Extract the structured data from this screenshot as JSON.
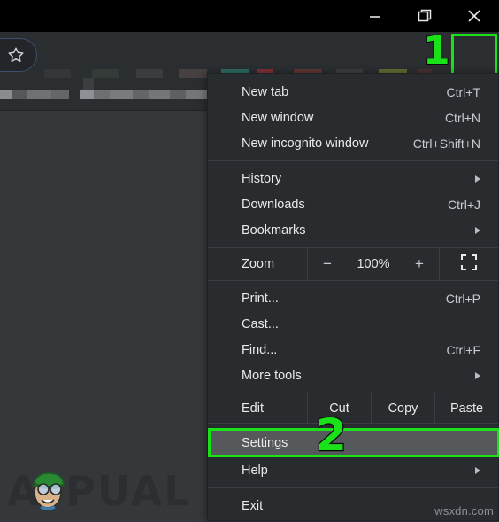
{
  "window": {
    "controls": [
      {
        "name": "minimize",
        "glyph": "minimize-icon"
      },
      {
        "name": "maximize",
        "glyph": "restore-icon"
      },
      {
        "name": "close",
        "glyph": "close-icon"
      }
    ]
  },
  "toolbar": {
    "bookmark_star": "star-icon",
    "menu_button": "three-dot-menu-icon",
    "annotation_1": "1"
  },
  "menu": {
    "groups": [
      {
        "items": [
          {
            "label": "New tab",
            "accel": "Ctrl+T",
            "arrow": false
          },
          {
            "label": "New window",
            "accel": "Ctrl+N",
            "arrow": false
          },
          {
            "label": "New incognito window",
            "accel": "Ctrl+Shift+N",
            "arrow": false
          }
        ]
      },
      {
        "items": [
          {
            "label": "History",
            "accel": "",
            "arrow": true
          },
          {
            "label": "Downloads",
            "accel": "Ctrl+J",
            "arrow": false
          },
          {
            "label": "Bookmarks",
            "accel": "",
            "arrow": true
          }
        ]
      }
    ],
    "zoom": {
      "label": "Zoom",
      "minus": "−",
      "value": "100%",
      "plus": "+",
      "fullscreen": "fullscreen-icon"
    },
    "tools": [
      {
        "label": "Print...",
        "accel": "Ctrl+P",
        "arrow": false
      },
      {
        "label": "Cast...",
        "accel": "",
        "arrow": false
      },
      {
        "label": "Find...",
        "accel": "Ctrl+F",
        "arrow": false
      },
      {
        "label": "More tools",
        "accel": "",
        "arrow": true
      }
    ],
    "edit_row": {
      "label": "Edit",
      "cut": "Cut",
      "copy": "Copy",
      "paste": "Paste"
    },
    "settings": {
      "label": "Settings",
      "annotation": "2"
    },
    "help": {
      "label": "Help",
      "arrow": true
    },
    "exit": {
      "label": "Exit"
    }
  },
  "branding": {
    "logo_text": "APPUALS",
    "watermark": "wsxdn.com"
  },
  "colors": {
    "menu_bg": "#292c2f",
    "menu_text": "#e8eaed",
    "highlight_bg": "#56595c",
    "annotation_green": "#19e219",
    "toolbar_bg": "#2b2e31",
    "titlebar_bg": "#000000",
    "page_bg": "#35383b"
  }
}
